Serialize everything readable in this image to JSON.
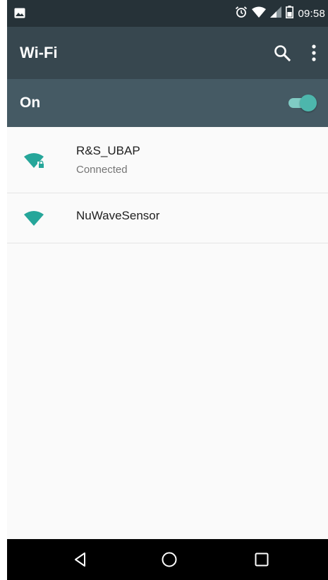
{
  "status_bar": {
    "time": "09:58",
    "icons": [
      "image-notification-icon",
      "alarm-icon",
      "wifi-signal-icon",
      "cell-signal-icon",
      "battery-icon"
    ]
  },
  "app_bar": {
    "title": "Wi-Fi",
    "icons": [
      "search-icon",
      "more-vert-icon"
    ]
  },
  "master_switch": {
    "label": "On",
    "state": "on"
  },
  "networks": [
    {
      "name": "R&S_UBAP",
      "status": "Connected",
      "secured": true
    },
    {
      "name": "NuWaveSensor",
      "status": "",
      "secured": false
    }
  ],
  "nav_bar": {
    "icons": [
      "back-icon",
      "home-icon",
      "recents-icon"
    ]
  },
  "colors": {
    "status_bar": "#263238",
    "app_bar": "#37474f",
    "switch_bar": "#455a64",
    "accent": "#26a69a",
    "toggle_thumb": "#4db6ac",
    "toggle_track": "#80cbc4",
    "background": "#fafafa",
    "nav_bar": "#000000"
  }
}
